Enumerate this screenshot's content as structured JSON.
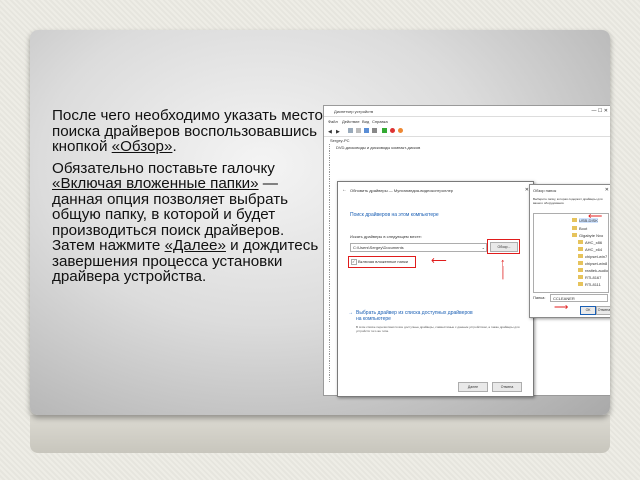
{
  "slide": {
    "para1": {
      "before": "После чего необходимо указать место поиска драйверов воспользовавшись кнопкой ",
      "link": "«Обзор»",
      "after": "."
    },
    "para2": {
      "p1": "Обязательно поставьте галочку ",
      "link1": "«Включая вложенные папки»",
      "p2": " — данная опция позволяет выбрать общую папку, в которой и будет производиться поиск драйверов. Затем нажмите ",
      "link2": "«Далее»",
      "p3": " и дождитесь завершения процесса установки драйвера устройства."
    }
  },
  "screenshot": {
    "devmgr_title": "Диспетчер устройств",
    "menu": [
      "Файл",
      "Действие",
      "Вид",
      "Справка"
    ],
    "pc_name": "Sergey-PC",
    "tree_first": "DVD-дисководы и дисководы компакт-дисков",
    "wizard_title": "Обновить драйверы — Мультимедиа-видеоконтроллер",
    "wizard_heading": "Поиск драйверов на этом компьютере",
    "search_label": "Искать драйверы в следующем месте:",
    "path_value": "C:\\Users\\Sergey\\Documents",
    "browse_button": "Обзор...",
    "include_sub": "Включая вложенные папки",
    "pick_link": "Выбрать драйвер из списка доступных драйверов на компьютере",
    "pick_desc": "В этом списке перечисляются все доступные драйверы, совместимые с данным устройством, а также драйверы для устройств того же типа.",
    "next_button": "Далее",
    "cancel_button": "Отмена",
    "browse_title": "Обзор папок",
    "browse_hint": "Выберите папку, которая содержит драйверы для вашего оборудования.",
    "folders": [
      "USB-DISK",
      "Boot",
      "Gigabyte Nvo",
      "AHC_x86",
      "AHC_x64",
      "chipset-win7",
      "chipset-win8",
      "realtek-audio",
      "RTL8167",
      "RTL8111"
    ],
    "folder_label": "Папка:",
    "folder_value": "CCLEANER",
    "ok_button": "ОК",
    "cancel2_button": "Отмена"
  }
}
